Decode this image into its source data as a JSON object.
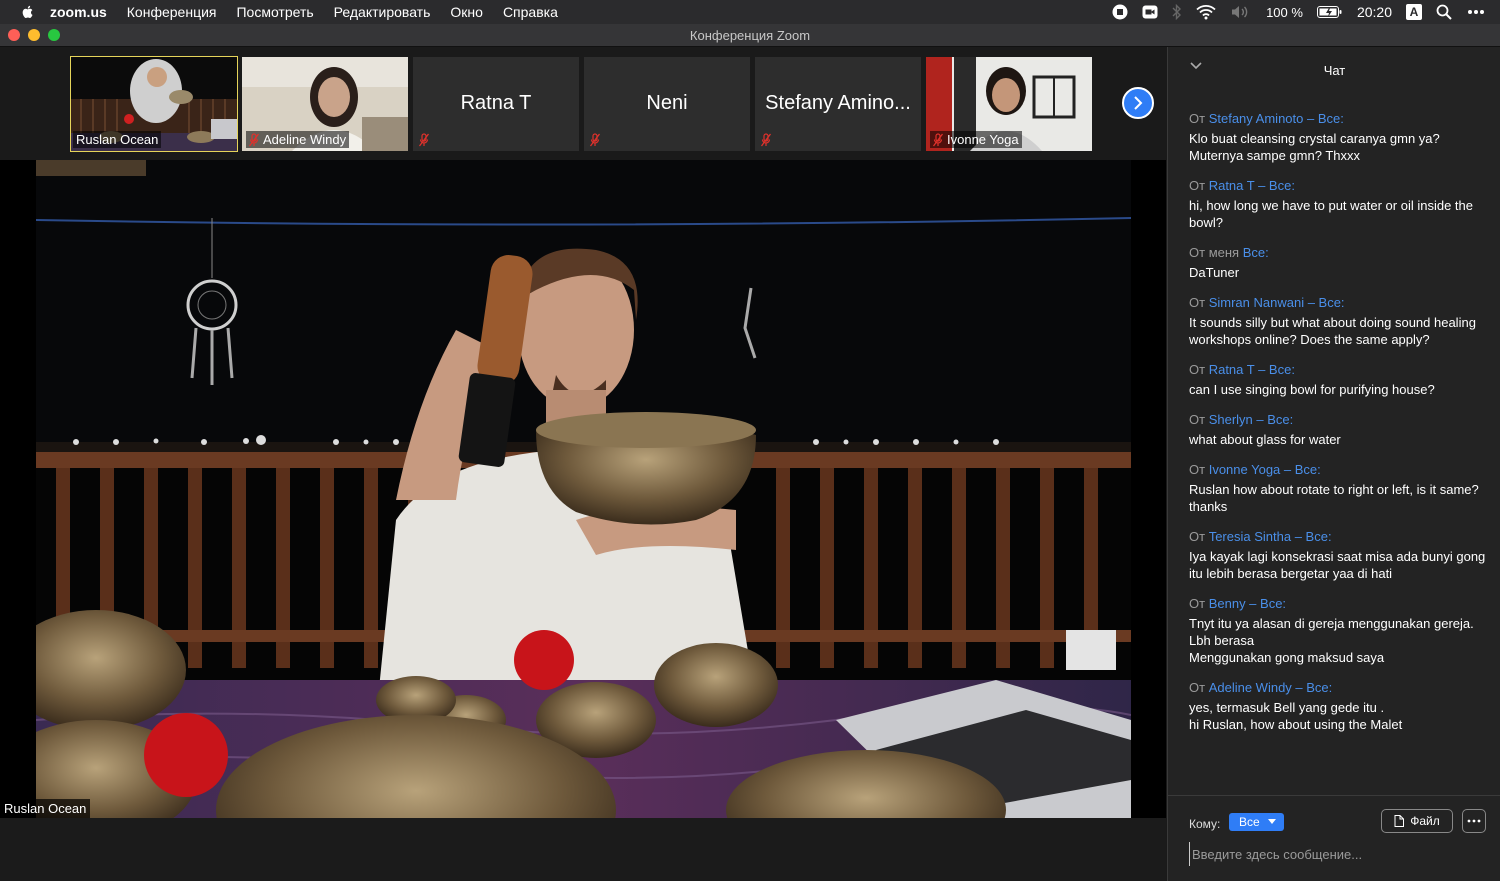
{
  "menubar": {
    "app_name": "zoom.us",
    "items": [
      "Конференция",
      "Посмотреть",
      "Редактировать",
      "Окно",
      "Справка"
    ],
    "battery": "100 %",
    "time": "20:20",
    "input_source": "A"
  },
  "window": {
    "title": "Конференция Zoom"
  },
  "gallery": {
    "tiles": [
      {
        "name": "Ruslan Ocean",
        "muted": false,
        "video": true,
        "active": true
      },
      {
        "name": "Adeline Windy",
        "muted": true,
        "video": true
      },
      {
        "name": "Ratna T",
        "muted": true,
        "video": false
      },
      {
        "name": "Neni",
        "muted": true,
        "video": false
      },
      {
        "name": "Stefany Amino...",
        "muted": true,
        "video": false
      },
      {
        "name": "Ivonne Yoga",
        "muted": true,
        "video": true
      }
    ]
  },
  "main_video": {
    "speaker_name": "Ruslan Ocean"
  },
  "chat": {
    "title": "Чат",
    "from_word": "От",
    "messages": [
      {
        "from": "Stefany Aminoto – Все:",
        "text": "Klo buat cleansing crystal caranya gmn ya?\nMuternya sampe gmn? Thxxx"
      },
      {
        "from": "Ratna T – Все:",
        "text": "hi, how long we have to put water or oil inside the bowl?"
      },
      {
        "from": "меня",
        "from_suffix": "Все:",
        "text": "DaTuner"
      },
      {
        "from": "Simran Nanwani – Все:",
        "text": "It sounds silly but what about doing sound healing workshops online? Does the same apply?"
      },
      {
        "from": "Ratna T – Все:",
        "text": "can I use singing bowl for purifying house?"
      },
      {
        "from": "Sherlyn – Все:",
        "text": "what about glass for water"
      },
      {
        "from": "Ivonne Yoga – Все:",
        "text": "Ruslan how about rotate to right or left, is it same? thanks"
      },
      {
        "from": "Teresia Sintha – Все:",
        "text": "Iya kayak lagi konsekrasi saat misa ada bunyi gong itu lebih berasa bergetar yaa di hati"
      },
      {
        "from": "Benny – Все:",
        "text": "Tnyt itu ya alasan di gereja menggunakan gereja. Lbh berasa\nMenggunakan gong maksud saya"
      },
      {
        "from": "Adeline Windy – Все:",
        "text": "yes, termasuk Bell yang gede itu .\nhi Ruslan, how about using the Malet"
      }
    ],
    "to_label": "Кому:",
    "to_value": "Все",
    "file_label": "Файл",
    "input_placeholder": "Введите здесь сообщение..."
  },
  "colors": {
    "accent": "#2f7df6",
    "chat_sender": "#4a8fe9",
    "active_speaker": "#e5d45a",
    "mute_red": "#e0312b"
  }
}
